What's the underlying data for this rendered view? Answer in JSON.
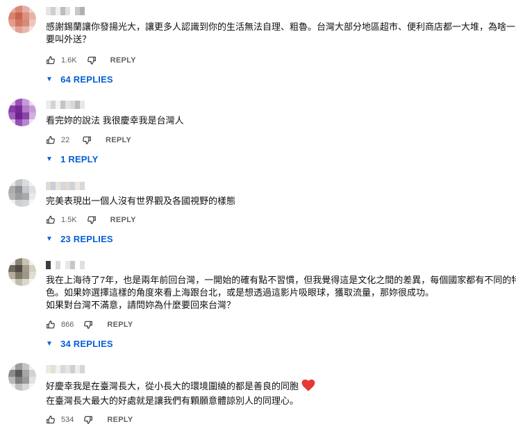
{
  "comments": [
    {
      "text_lines": [
        "感謝錫蘭讓你發揚光大，讓更多人認識到你的生活無法自理、粗魯。台灣大部分地區超市、便利商店都一大堆，為啥一定",
        "要叫外送？"
      ],
      "likes": "1.6K",
      "reply_label": "REPLY",
      "replies_label": "64 REPLIES"
    },
    {
      "text_lines": [
        "看完妳的說法 我很慶幸我是台灣人"
      ],
      "likes": "22",
      "reply_label": "REPLY",
      "replies_label": "1 REPLY"
    },
    {
      "text_lines": [
        "完美表現出一個人沒有世界觀及各國視野的樣態"
      ],
      "likes": "1.5K",
      "reply_label": "REPLY",
      "replies_label": "23 REPLIES"
    },
    {
      "text_lines": [
        "我在上海待了7年，也是兩年前回台灣，一開始的確有點不習慣，但我覺得這是文化之間的差異，每個國家都有不同的特",
        "色。如果妳選擇這樣的角度來看上海跟台北，或是想透過這影片吸眼球，獲取流量，那妳很成功。",
        "如果對台灣不滿意，請問妳為什麼要回來台灣？"
      ],
      "likes": "866",
      "reply_label": "REPLY",
      "replies_label": "34 REPLIES"
    },
    {
      "text_lines": [
        "好慶幸我是在臺灣長大，從小長大的環境圍繞的都是善良的同胞",
        "在臺灣長大最大的好處就是讓我們有顆願意體諒別人的同理心。"
      ],
      "likes": "534",
      "reply_label": "REPLY",
      "replies_label": ""
    }
  ],
  "colors": {
    "link_blue": "#065fd4",
    "meta_gray": "#606060",
    "heart_red": "#e53935"
  },
  "icons": {
    "like": "thumb-up-icon",
    "dislike": "thumb-down-icon",
    "expand": "caret-down-icon",
    "heart": "heart-icon"
  }
}
